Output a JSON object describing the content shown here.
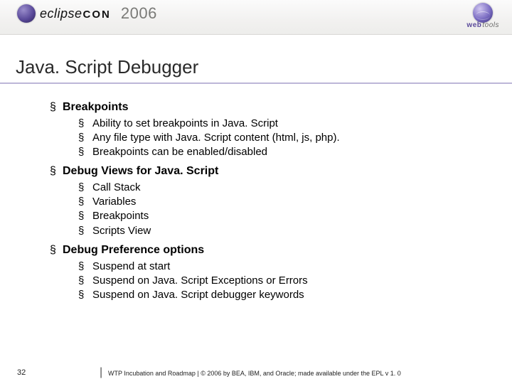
{
  "header": {
    "logo_text_a": "eclipse",
    "logo_text_b": "CON",
    "year": "2006",
    "right_logo_a": "web",
    "right_logo_b": "tools"
  },
  "title": "Java. Script Debugger",
  "sections": [
    {
      "heading": "Breakpoints",
      "items": [
        "Ability to set breakpoints in Java. Script",
        "Any file type with Java. Script content (html, js, php).",
        "Breakpoints can be enabled/disabled"
      ]
    },
    {
      "heading": "Debug Views for Java. Script",
      "items": [
        "Call Stack",
        "Variables",
        "Breakpoints",
        "Scripts View"
      ]
    },
    {
      "heading": "Debug Preference options",
      "items": [
        "Suspend at start",
        "Suspend on Java. Script Exceptions or Errors",
        "Suspend on Java. Script debugger keywords"
      ]
    }
  ],
  "footer": {
    "page": "32",
    "text": "WTP Incubation and Roadmap  |  © 2006 by BEA, IBM, and Oracle; made available under the EPL v 1. 0"
  }
}
